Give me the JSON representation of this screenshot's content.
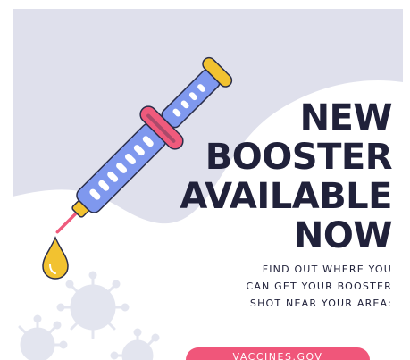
{
  "headline": {
    "line1": "NEW",
    "line2": "BOOSTER",
    "line3": "AVAILABLE",
    "line4": "NOW"
  },
  "subtext": {
    "line1": "FIND OUT WHERE YOU",
    "line2": "CAN GET YOUR BOOSTER",
    "line3": "SHOT NEAR YOUR AREA:"
  },
  "cta": {
    "label": "VACCINES.GOV"
  },
  "colors": {
    "background_blob": "#dfe0ec",
    "headline_text": "#20213a",
    "syringe_barrel": "#7f98ee",
    "syringe_ring": "#ef5a7c",
    "syringe_cap": "#f2c230",
    "cta_background": "#f0567a",
    "virus_particles": "#e3e5ef"
  },
  "icons": [
    "syringe-illustration",
    "virus-particle-icon",
    "drop-icon"
  ]
}
